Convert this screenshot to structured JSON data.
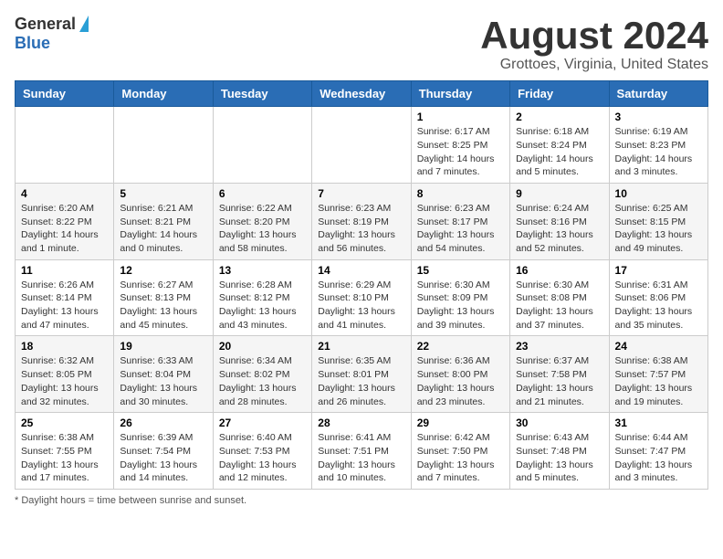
{
  "logo": {
    "general": "General",
    "blue": "Blue"
  },
  "title": "August 2024",
  "location": "Grottoes, Virginia, United States",
  "days_of_week": [
    "Sunday",
    "Monday",
    "Tuesday",
    "Wednesday",
    "Thursday",
    "Friday",
    "Saturday"
  ],
  "footer_note": "Daylight hours",
  "weeks": [
    [
      {
        "day": "",
        "info": ""
      },
      {
        "day": "",
        "info": ""
      },
      {
        "day": "",
        "info": ""
      },
      {
        "day": "",
        "info": ""
      },
      {
        "day": "1",
        "info": "Sunrise: 6:17 AM\nSunset: 8:25 PM\nDaylight: 14 hours\nand 7 minutes."
      },
      {
        "day": "2",
        "info": "Sunrise: 6:18 AM\nSunset: 8:24 PM\nDaylight: 14 hours\nand 5 minutes."
      },
      {
        "day": "3",
        "info": "Sunrise: 6:19 AM\nSunset: 8:23 PM\nDaylight: 14 hours\nand 3 minutes."
      }
    ],
    [
      {
        "day": "4",
        "info": "Sunrise: 6:20 AM\nSunset: 8:22 PM\nDaylight: 14 hours\nand 1 minute."
      },
      {
        "day": "5",
        "info": "Sunrise: 6:21 AM\nSunset: 8:21 PM\nDaylight: 14 hours\nand 0 minutes."
      },
      {
        "day": "6",
        "info": "Sunrise: 6:22 AM\nSunset: 8:20 PM\nDaylight: 13 hours\nand 58 minutes."
      },
      {
        "day": "7",
        "info": "Sunrise: 6:23 AM\nSunset: 8:19 PM\nDaylight: 13 hours\nand 56 minutes."
      },
      {
        "day": "8",
        "info": "Sunrise: 6:23 AM\nSunset: 8:17 PM\nDaylight: 13 hours\nand 54 minutes."
      },
      {
        "day": "9",
        "info": "Sunrise: 6:24 AM\nSunset: 8:16 PM\nDaylight: 13 hours\nand 52 minutes."
      },
      {
        "day": "10",
        "info": "Sunrise: 6:25 AM\nSunset: 8:15 PM\nDaylight: 13 hours\nand 49 minutes."
      }
    ],
    [
      {
        "day": "11",
        "info": "Sunrise: 6:26 AM\nSunset: 8:14 PM\nDaylight: 13 hours\nand 47 minutes."
      },
      {
        "day": "12",
        "info": "Sunrise: 6:27 AM\nSunset: 8:13 PM\nDaylight: 13 hours\nand 45 minutes."
      },
      {
        "day": "13",
        "info": "Sunrise: 6:28 AM\nSunset: 8:12 PM\nDaylight: 13 hours\nand 43 minutes."
      },
      {
        "day": "14",
        "info": "Sunrise: 6:29 AM\nSunset: 8:10 PM\nDaylight: 13 hours\nand 41 minutes."
      },
      {
        "day": "15",
        "info": "Sunrise: 6:30 AM\nSunset: 8:09 PM\nDaylight: 13 hours\nand 39 minutes."
      },
      {
        "day": "16",
        "info": "Sunrise: 6:30 AM\nSunset: 8:08 PM\nDaylight: 13 hours\nand 37 minutes."
      },
      {
        "day": "17",
        "info": "Sunrise: 6:31 AM\nSunset: 8:06 PM\nDaylight: 13 hours\nand 35 minutes."
      }
    ],
    [
      {
        "day": "18",
        "info": "Sunrise: 6:32 AM\nSunset: 8:05 PM\nDaylight: 13 hours\nand 32 minutes."
      },
      {
        "day": "19",
        "info": "Sunrise: 6:33 AM\nSunset: 8:04 PM\nDaylight: 13 hours\nand 30 minutes."
      },
      {
        "day": "20",
        "info": "Sunrise: 6:34 AM\nSunset: 8:02 PM\nDaylight: 13 hours\nand 28 minutes."
      },
      {
        "day": "21",
        "info": "Sunrise: 6:35 AM\nSunset: 8:01 PM\nDaylight: 13 hours\nand 26 minutes."
      },
      {
        "day": "22",
        "info": "Sunrise: 6:36 AM\nSunset: 8:00 PM\nDaylight: 13 hours\nand 23 minutes."
      },
      {
        "day": "23",
        "info": "Sunrise: 6:37 AM\nSunset: 7:58 PM\nDaylight: 13 hours\nand 21 minutes."
      },
      {
        "day": "24",
        "info": "Sunrise: 6:38 AM\nSunset: 7:57 PM\nDaylight: 13 hours\nand 19 minutes."
      }
    ],
    [
      {
        "day": "25",
        "info": "Sunrise: 6:38 AM\nSunset: 7:55 PM\nDaylight: 13 hours\nand 17 minutes."
      },
      {
        "day": "26",
        "info": "Sunrise: 6:39 AM\nSunset: 7:54 PM\nDaylight: 13 hours\nand 14 minutes."
      },
      {
        "day": "27",
        "info": "Sunrise: 6:40 AM\nSunset: 7:53 PM\nDaylight: 13 hours\nand 12 minutes."
      },
      {
        "day": "28",
        "info": "Sunrise: 6:41 AM\nSunset: 7:51 PM\nDaylight: 13 hours\nand 10 minutes."
      },
      {
        "day": "29",
        "info": "Sunrise: 6:42 AM\nSunset: 7:50 PM\nDaylight: 13 hours\nand 7 minutes."
      },
      {
        "day": "30",
        "info": "Sunrise: 6:43 AM\nSunset: 7:48 PM\nDaylight: 13 hours\nand 5 minutes."
      },
      {
        "day": "31",
        "info": "Sunrise: 6:44 AM\nSunset: 7:47 PM\nDaylight: 13 hours\nand 3 minutes."
      }
    ]
  ]
}
